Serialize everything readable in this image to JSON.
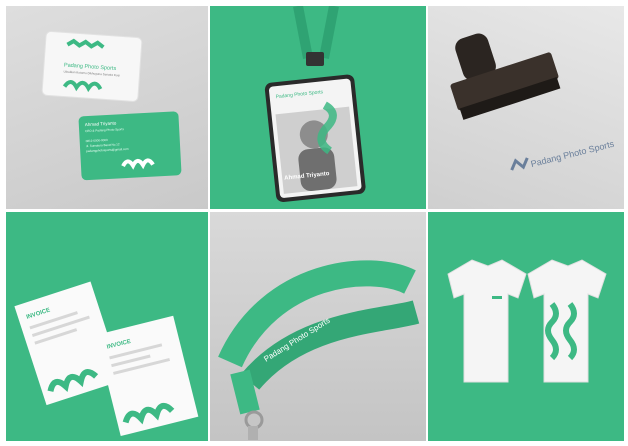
{
  "brand": {
    "name": "Padang Photo Sports",
    "tagline": "Ubudkan Kotamu Dikhuguna Sanatra Kosi",
    "card_name": "Ahmad Triyanto",
    "card_role": "CEO & Padang Photo Sports",
    "card_phone": "0812-0000-0000",
    "card_address": "Jl. Sumatera Barat No.12",
    "card_email": "padangphotosports@gmail.com",
    "badge_person": "Ahmad Triyanto",
    "invoice_title": "INVOICE",
    "stamp_text": "Padang Photo Sports"
  },
  "colors": {
    "brand_green": "#3db984",
    "light_gray": "#dedede",
    "white": "#ffffff"
  },
  "tiles": [
    {
      "name": "business-cards"
    },
    {
      "name": "id-badge-lanyard"
    },
    {
      "name": "rubber-stamp"
    },
    {
      "name": "letterhead-invoice"
    },
    {
      "name": "lanyard-strap"
    },
    {
      "name": "t-shirts"
    }
  ]
}
